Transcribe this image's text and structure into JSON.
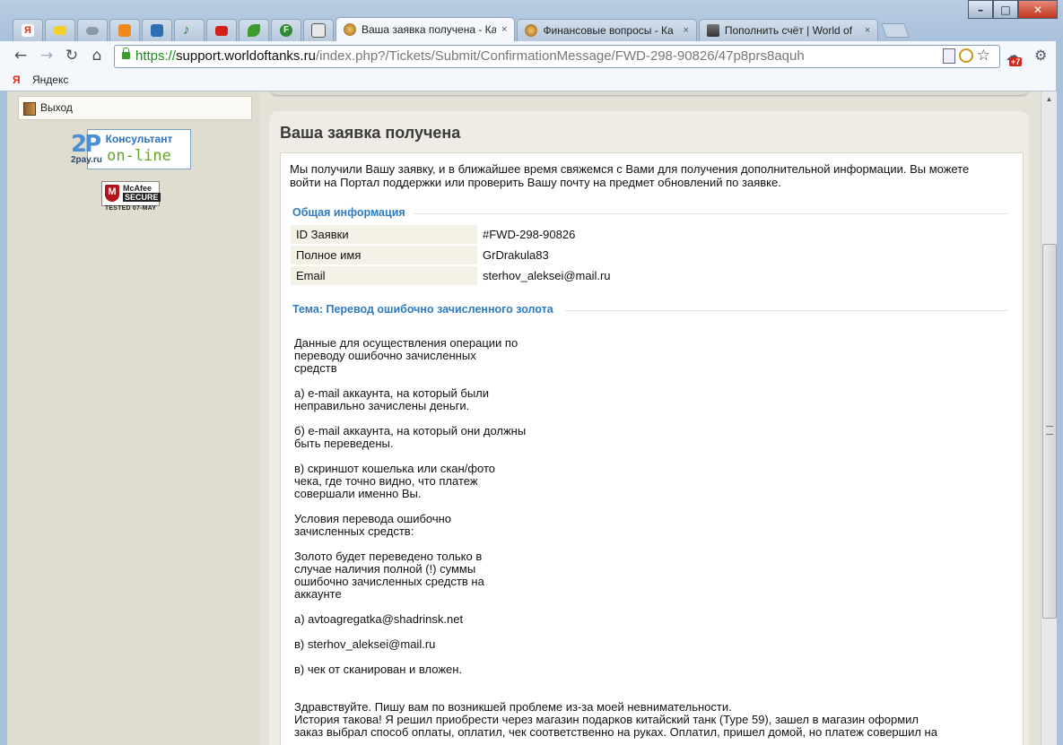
{
  "window": {
    "controls": [
      "–",
      "□",
      "✕"
    ]
  },
  "tabs": [
    {
      "title": "Ваша заявка получена - Ка",
      "close": "×",
      "active": true
    },
    {
      "title": "Финансовые вопросы - Ка",
      "close": "×",
      "active": false
    },
    {
      "title": "Пополнить счёт | World of",
      "close": "×",
      "active": false
    }
  ],
  "pinned_tabs": [
    "yandex-icon",
    "folder-icon",
    "cloud-icon",
    "orange-app-icon",
    "blue-app-icon",
    "music-note-icon",
    "youtube-icon",
    "leaf-icon",
    "green-f-icon",
    "doc-icon"
  ],
  "toolbar": {
    "back": "←",
    "forward": "→",
    "reload": "↻",
    "home": "⌂",
    "url_scheme": "https://",
    "url_host": "support.worldoftanks.ru",
    "url_path": "/index.php?/Tickets/Submit/ConfirmationMessage/FWD-298-90826/47p8prs8aquh",
    "star": "☆",
    "wrench": "🔧",
    "badge": "+7"
  },
  "bookmarks": {
    "yandex_icon": "Я",
    "yandex_label": "Яндекс"
  },
  "sidebar": {
    "exit_label": "Выход",
    "consult_top": "Консультант",
    "consult_bottom": "on-line",
    "twopay_logo": "2P",
    "twopay_sub": "2pay.ru",
    "mcafee_name": "McAfee",
    "mcafee_secure": "SECURE",
    "mcafee_tested": "TESTED 07-MAY"
  },
  "content": {
    "title": "Ваша заявка получена",
    "intro": "Мы получили Вашу заявку, и в ближайшее время свяжемся с Вами для получения дополнительной информации. Вы можете войти на Портал поддержки или проверить Вашу почту на предмет обновлений по заявке.",
    "general_header": "Общая информация",
    "info": [
      {
        "key": "ID Заявки",
        "value": "#FWD-298-90826"
      },
      {
        "key": "Полное имя",
        "value": "GrDrakula83"
      },
      {
        "key": "Email",
        "value": "sterhov_aleksei@mail.ru"
      }
    ],
    "topic_header": "Тема: Перевод ошибочно зачисленного золота",
    "message": "Данные для осуществления операции по\nпереводу ошибочно зачисленных\nсредств\n\nа) e-mail аккаунта, на который были\nнеправильно зачислены деньги.\n\nб) e-mail аккаунта, на который они должны\nбыть переведены.\n\nв) скриншот кошелька или скан/фото\nчека, где точно видно, что платеж\nсовершали именно Вы.\n\nУсловия перевода ошибочно\nзачисленных средств:\n\nЗолото будет переведено только в\nслучае наличия полной (!) суммы\nошибочно зачисленных средств на\nаккаунте\n\nа) avtoagregatka@shadrinsk.net\n\nв) sterhov_aleksei@mail.ru\n\nв) чек от сканирован и вложен.",
    "message2": "Здравствуйте. Пишу вам по возникшей проблеме из-за моей невнимательности.\nИстория такова! Я решил приобрести через магазин подарков китайский танк (Type 59), зашел в магазин оформил\nзаказ выбрал способ оплаты, оплатил, чек соответственно на руках. Оплатил, пришел домой, но платеж совершил на"
  },
  "colors": {
    "section_header": "#2e7bbf",
    "tab_active": "#f4f7fb",
    "page_bg": "#e4e1d6"
  }
}
